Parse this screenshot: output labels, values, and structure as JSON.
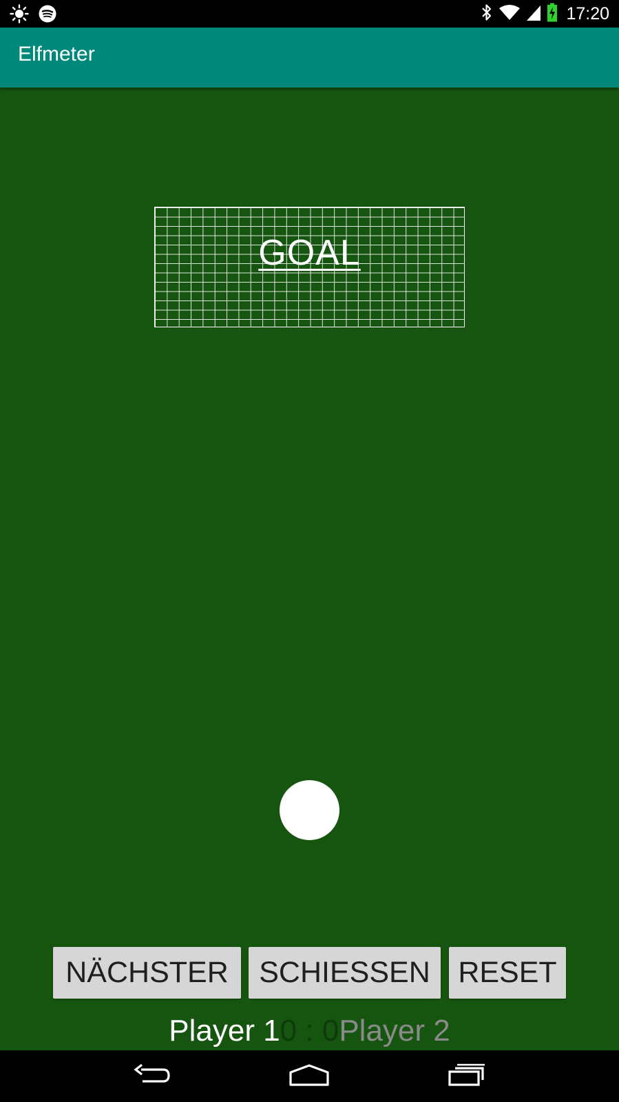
{
  "status_bar": {
    "time": "17:20",
    "icons": [
      "brightness-icon",
      "spotify-icon",
      "bluetooth-icon",
      "wifi-icon",
      "signal-icon",
      "battery-charging-icon"
    ],
    "battery_color": "#2fd12f"
  },
  "app_bar": {
    "title": "Elfmeter",
    "color": "#00887a"
  },
  "game": {
    "field_color": "#16550f",
    "goal_label": "GOAL",
    "buttons": {
      "next": "NÄCHSTER",
      "shoot": "SCHIESSEN",
      "reset": "RESET"
    },
    "score": {
      "player1_name": "Player 1",
      "player1_score": "0",
      "separator": " : ",
      "player2_score": "0",
      "player2_name": "Player 2"
    }
  },
  "nav_bar": {
    "icons": [
      "back-icon",
      "home-icon",
      "recent-apps-icon"
    ]
  }
}
